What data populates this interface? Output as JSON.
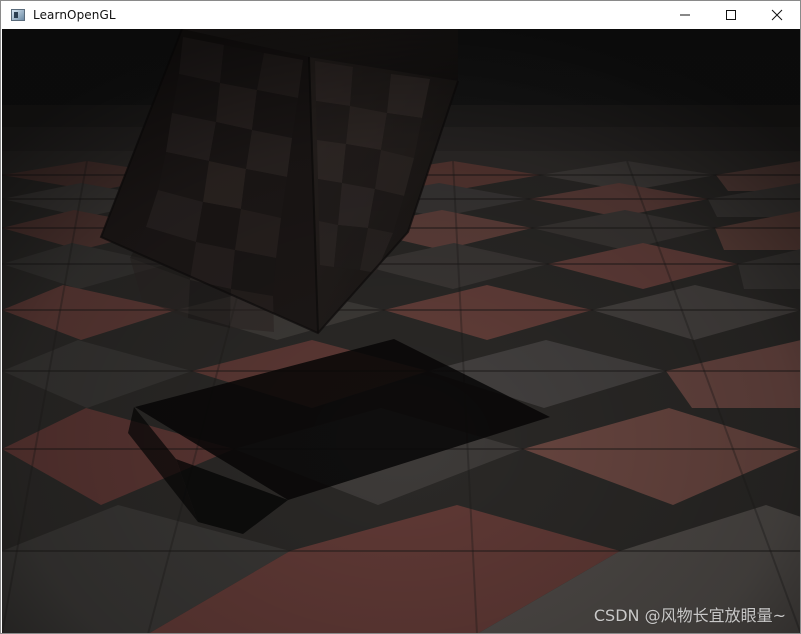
{
  "window": {
    "title": "LearnOpenGL",
    "icon": "window-app-icon",
    "controls": {
      "minimize_icon": "minimize-icon",
      "maximize_icon": "maximize-icon",
      "close_icon": "close-icon"
    }
  },
  "scene": {
    "description_type": "3d-render",
    "watermark": "CSDN @风物长宜放眼量~",
    "colors": {
      "floor_dark": "#3a3836",
      "floor_red": "#5a3934",
      "cube": "#211c1a",
      "shadow": "#080807",
      "background": "#171717"
    }
  }
}
